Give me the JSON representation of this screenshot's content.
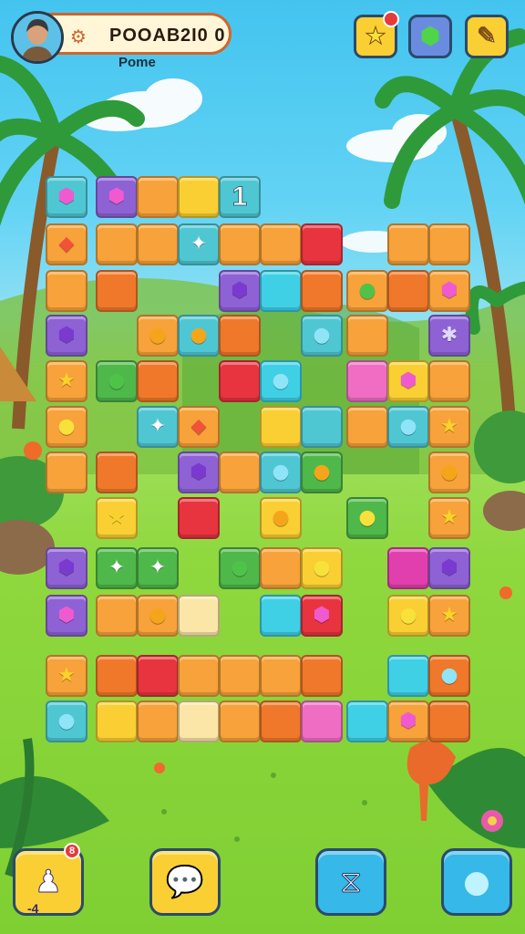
{
  "hud": {
    "score_label": "POOAB",
    "score_value": "2I0 0",
    "sub_label": "Pome"
  },
  "icons": {
    "settings": "gear-icon",
    "star_button": "star-icon",
    "gem_button": "green-gem-icon",
    "edit_button": "pencil-icon",
    "booster_left": "chess-piece-icon",
    "booster_chat": "chat-bubble-icon",
    "booster_shuffle": "shuffle-icon",
    "booster_bubble": "bubble-icon"
  },
  "counts": {
    "top_star_badge": "",
    "bottom_left_badge": "8",
    "bottom_left_counter": "-4"
  },
  "board": {
    "number_tile": "1",
    "tiles": [
      [
        "teal",
        "gem-pink"
      ],
      [
        "purple",
        "gem-pink"
      ],
      [
        "orange",
        ""
      ],
      [
        "yellow",
        ""
      ],
      [
        "teal",
        "num"
      ],
      [
        "orange",
        "gem-red"
      ],
      [
        "orange",
        ""
      ],
      [
        "orange",
        ""
      ],
      [
        "teal",
        "gem-white"
      ],
      [
        "orange",
        ""
      ],
      [
        "orange",
        ""
      ],
      [
        "red",
        ""
      ],
      [
        "orange",
        ""
      ],
      [
        "orange",
        ""
      ],
      [
        "orange",
        ""
      ],
      [
        "dorange",
        ""
      ],
      [
        "purple",
        "gem-purple"
      ],
      [
        "cyan",
        ""
      ],
      [
        "dorange",
        ""
      ],
      [
        "orange",
        "gem-green"
      ],
      [
        "dorange",
        ""
      ],
      [
        "orange",
        "gem-pink"
      ],
      [
        "purple",
        "gem-purple"
      ],
      [
        "orange",
        "gem-orange"
      ],
      [
        "teal",
        "gem-orange"
      ],
      [
        "dorange",
        ""
      ],
      [
        "teal",
        "gem-blue"
      ],
      [
        "orange",
        ""
      ],
      [
        "purple",
        "gem-sparkle"
      ],
      [
        "orange",
        "gem-star"
      ],
      [
        "green",
        "gem-green"
      ],
      [
        "dorange",
        ""
      ],
      [
        "red",
        ""
      ],
      [
        "cyan",
        "gem-blue"
      ],
      [
        "pink",
        ""
      ],
      [
        "yellow",
        "gem-pink"
      ],
      [
        "orange",
        ""
      ],
      [
        "orange",
        "gem-yellow"
      ],
      [
        "teal",
        "gem-white"
      ],
      [
        "orange",
        "gem-red"
      ],
      [
        "yellow",
        ""
      ],
      [
        "teal",
        ""
      ],
      [
        "orange",
        ""
      ],
      [
        "teal",
        "gem-blue"
      ],
      [
        "orange",
        "gem-star"
      ],
      [
        "orange",
        ""
      ],
      [
        "dorange",
        ""
      ],
      [
        "purple",
        "gem-purple"
      ],
      [
        "orange",
        ""
      ],
      [
        "teal",
        "gem-blue"
      ],
      [
        "green",
        "gem-orange"
      ],
      [
        "orange",
        "gem-orange"
      ],
      [
        "yellow",
        "gem-star"
      ],
      [
        "red",
        ""
      ],
      [
        "yellow",
        "gem-orange"
      ],
      [
        "green",
        "gem-yellow"
      ],
      [
        "orange",
        "gem-star"
      ],
      [
        "purple",
        "gem-purple"
      ],
      [
        "green",
        "gem-white"
      ],
      [
        "green",
        "gem-white"
      ],
      [
        "green",
        "gem-green"
      ],
      [
        "orange",
        ""
      ],
      [
        "yellow",
        "gem-yellow"
      ],
      [
        "magenta",
        ""
      ],
      [
        "purple",
        "gem-purple"
      ],
      [
        "purple",
        "gem-pink"
      ],
      [
        "orange",
        ""
      ],
      [
        "orange",
        "gem-orange"
      ],
      [
        "cream",
        ""
      ],
      [
        "cyan",
        ""
      ],
      [
        "red",
        "gem-pink"
      ],
      [
        "yellow",
        "gem-yellow"
      ],
      [
        "orange",
        "gem-star"
      ],
      [
        "orange",
        "gem-star"
      ],
      [
        "dorange",
        ""
      ],
      [
        "red",
        ""
      ],
      [
        "orange",
        ""
      ],
      [
        "orange",
        ""
      ],
      [
        "orange",
        ""
      ],
      [
        "dorange",
        ""
      ],
      [
        "cyan",
        ""
      ],
      [
        "dorange",
        "gem-blue"
      ],
      [
        "teal",
        "gem-blue"
      ],
      [
        "yellow",
        ""
      ],
      [
        "orange",
        ""
      ],
      [
        "cream",
        ""
      ],
      [
        "orange",
        ""
      ],
      [
        "dorange",
        ""
      ],
      [
        "pink",
        ""
      ],
      [
        "cyan",
        ""
      ],
      [
        "orange",
        "gem-pink"
      ],
      [
        "dorange",
        ""
      ]
    ]
  },
  "colors": {
    "orange": "#f7a23a",
    "dorange": "#f0782a",
    "yellow": "#f9cf33",
    "red": "#e8343f",
    "teal": "#4fc7d3",
    "cyan": "#3fd0e6",
    "purple": "#8e62d4",
    "green": "#4fb84a",
    "pink": "#ef6ec4",
    "magenta": "#e23fae",
    "cream": "#fbe6a8"
  }
}
